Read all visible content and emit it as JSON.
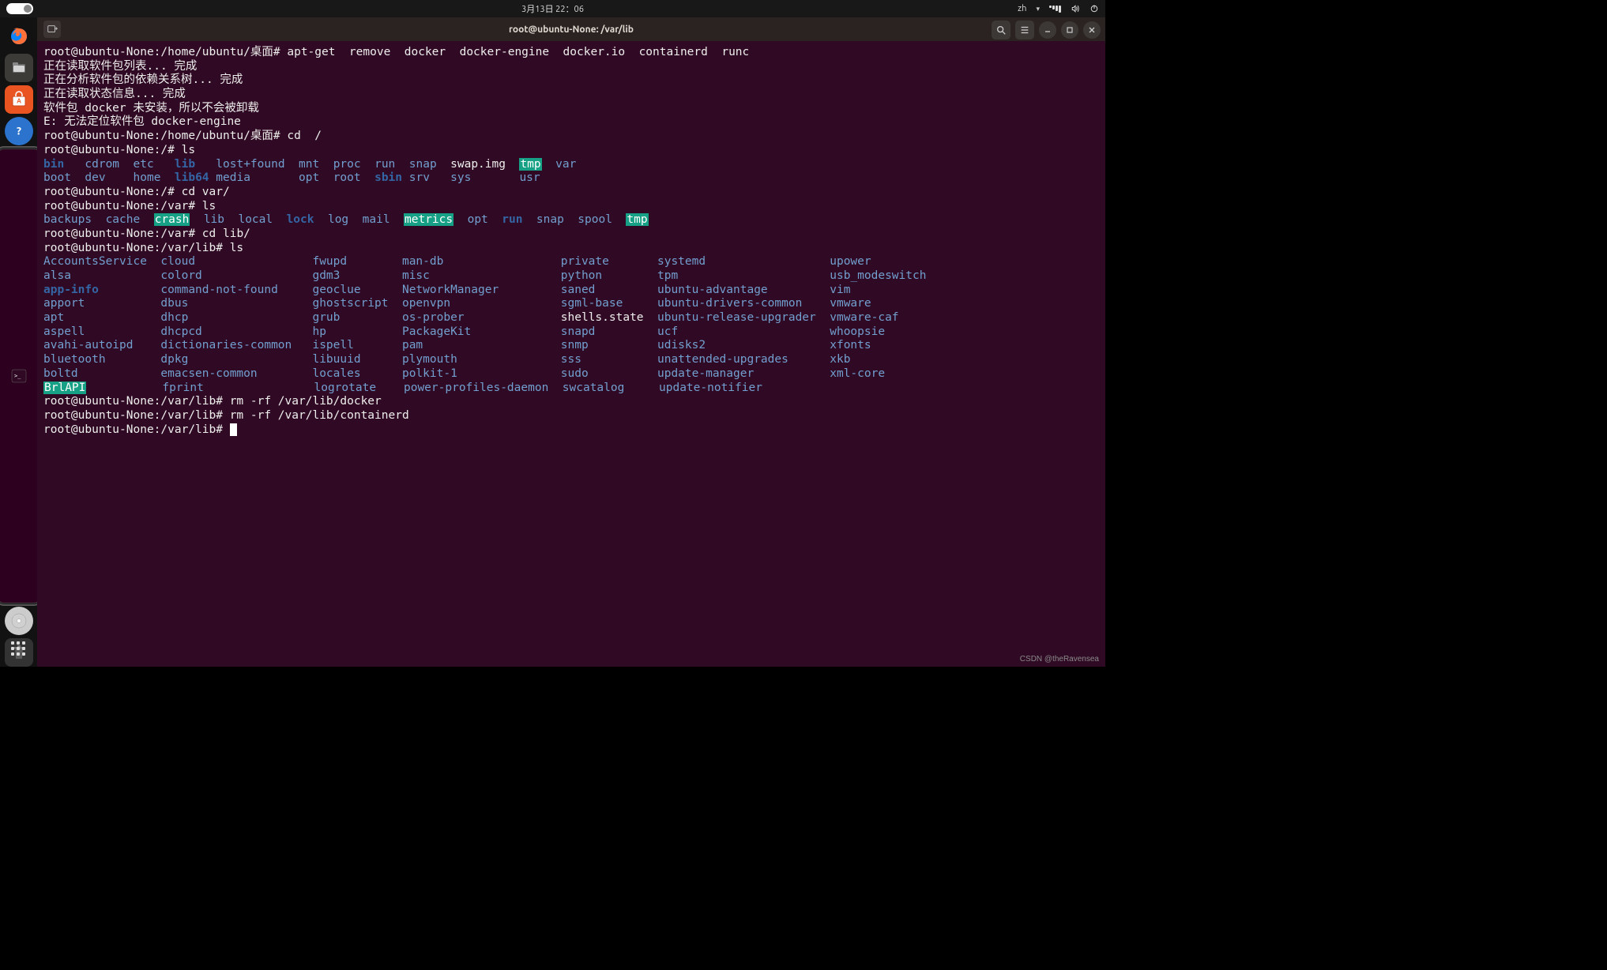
{
  "topbar": {
    "datetime": "3月13日  22：06",
    "lang": "zh"
  },
  "dock": {
    "items": [
      {
        "name": "firefox"
      },
      {
        "name": "files"
      },
      {
        "name": "software"
      },
      {
        "name": "help"
      },
      {
        "name": "terminal"
      },
      {
        "name": "disc"
      },
      {
        "name": "trash"
      }
    ]
  },
  "window": {
    "title": "root@ubuntu-None: /var/lib"
  },
  "terminal": {
    "lines": [
      {
        "prompt": "root@ubuntu-None:/home/ubuntu/桌面# ",
        "cmd": "apt-get  remove  docker  docker-engine  docker.io  containerd  runc"
      },
      {
        "text": "正在读取软件包列表... 完成"
      },
      {
        "text": "正在分析软件包的依赖关系树... 完成"
      },
      {
        "text": "正在读取状态信息... 完成"
      },
      {
        "text": "软件包 docker 未安装，所以不会被卸载"
      },
      {
        "text": "E: 无法定位软件包 docker-engine"
      },
      {
        "prompt": "root@ubuntu-None:/home/ubuntu/桌面# ",
        "cmd": "cd  /"
      },
      {
        "prompt": "root@ubuntu-None:/# ",
        "cmd": "ls"
      }
    ],
    "ls_root": {
      "row1": [
        {
          "t": "bin",
          "c": "db",
          "w": 6
        },
        {
          "t": "cdrom",
          "c": "d",
          "w": 7
        },
        {
          "t": "etc",
          "c": "d",
          "w": 6
        },
        {
          "t": "lib",
          "c": "db",
          "w": 6
        },
        {
          "t": "lost+found",
          "c": "d",
          "w": 12
        },
        {
          "t": "mnt",
          "c": "d",
          "w": 5
        },
        {
          "t": "proc",
          "c": "d",
          "w": 6
        },
        {
          "t": "run",
          "c": "d",
          "w": 5
        },
        {
          "t": "snap",
          "c": "d",
          "w": 6
        },
        {
          "t": "swap.img",
          "c": "w",
          "w": 10
        },
        {
          "t": "tmp",
          "c": "hl",
          "w": 5
        },
        {
          "t": "var",
          "c": "d",
          "w": 3
        }
      ],
      "row2": [
        {
          "t": "boot",
          "c": "d",
          "w": 6
        },
        {
          "t": "dev",
          "c": "d",
          "w": 7
        },
        {
          "t": "home",
          "c": "d",
          "w": 6
        },
        {
          "t": "lib64",
          "c": "db",
          "w": 6
        },
        {
          "t": "media",
          "c": "d",
          "w": 12
        },
        {
          "t": "opt",
          "c": "d",
          "w": 5
        },
        {
          "t": "root",
          "c": "d",
          "w": 6
        },
        {
          "t": "sbin",
          "c": "db",
          "w": 5
        },
        {
          "t": "srv",
          "c": "d",
          "w": 6
        },
        {
          "t": "sys",
          "c": "d",
          "w": 10
        },
        {
          "t": "usr",
          "c": "d",
          "w": 5
        }
      ]
    },
    "lines2": [
      {
        "prompt": "root@ubuntu-None:/# ",
        "cmd": "cd var/"
      },
      {
        "prompt": "root@ubuntu-None:/var# ",
        "cmd": "ls"
      }
    ],
    "ls_var": [
      {
        "t": "backups",
        "c": "d",
        "w": 9
      },
      {
        "t": "cache",
        "c": "d",
        "w": 7
      },
      {
        "t": "crash",
        "c": "hl",
        "w": 7
      },
      {
        "t": "lib",
        "c": "d",
        "w": 5
      },
      {
        "t": "local",
        "c": "d",
        "w": 7
      },
      {
        "t": "lock",
        "c": "db",
        "w": 6
      },
      {
        "t": "log",
        "c": "d",
        "w": 5
      },
      {
        "t": "mail",
        "c": "d",
        "w": 6
      },
      {
        "t": "metrics",
        "c": "hl",
        "w": 9
      },
      {
        "t": "opt",
        "c": "d",
        "w": 5
      },
      {
        "t": "run",
        "c": "db",
        "w": 5
      },
      {
        "t": "snap",
        "c": "d",
        "w": 6
      },
      {
        "t": "spool",
        "c": "d",
        "w": 7
      },
      {
        "t": "tmp",
        "c": "hl",
        "w": 5
      }
    ],
    "lines3": [
      {
        "prompt": "root@ubuntu-None:/var# ",
        "cmd": "cd lib/"
      },
      {
        "prompt": "root@ubuntu-None:/var/lib# ",
        "cmd": "ls"
      }
    ],
    "ls_varlib": {
      "cols": [
        [
          "AccountsService",
          "alsa",
          "app-info",
          "apport",
          "apt",
          "aspell",
          "avahi-autoipd",
          "bluetooth",
          "boltd",
          "BrlAPI"
        ],
        [
          "cloud",
          "colord",
          "command-not-found",
          "dbus",
          "dhcp",
          "dhcpcd",
          "dictionaries-common",
          "dpkg",
          "emacsen-common",
          "fprint"
        ],
        [
          "fwupd",
          "gdm3",
          "geoclue",
          "ghostscript",
          "grub",
          "hp",
          "ispell",
          "libuuid",
          "locales",
          "logrotate"
        ],
        [
          "man-db",
          "misc",
          "NetworkManager",
          "openvpn",
          "os-prober",
          "PackageKit",
          "pam",
          "plymouth",
          "polkit-1",
          "power-profiles-daemon"
        ],
        [
          "private",
          "python",
          "saned",
          "sgml-base",
          "shells.state",
          "snapd",
          "snmp",
          "sss",
          "sudo",
          "swcatalog"
        ],
        [
          "systemd",
          "tpm",
          "ubuntu-advantage",
          "ubuntu-drivers-common",
          "ubuntu-release-upgrader",
          "ucf",
          "udisks2",
          "unattended-upgrades",
          "update-manager",
          "update-notifier"
        ],
        [
          "upower",
          "usb_modeswitch",
          "vim",
          "vmware",
          "vmware-caf",
          "whoopsie",
          "xfonts",
          "xkb",
          "xml-core"
        ]
      ],
      "special": {
        "app-info": "db",
        "BrlAPI": "hl",
        "shells.state": "w"
      }
    },
    "lines4": [
      {
        "prompt": "root@ubuntu-None:/var/lib# ",
        "cmd": "rm -rf /var/lib/docker"
      },
      {
        "prompt": "root@ubuntu-None:/var/lib# ",
        "cmd": "rm -rf /var/lib/containerd"
      },
      {
        "prompt": "root@ubuntu-None:/var/lib# ",
        "cmd": "",
        "cursor": true
      }
    ]
  },
  "watermark": "CSDN @theRavensea"
}
